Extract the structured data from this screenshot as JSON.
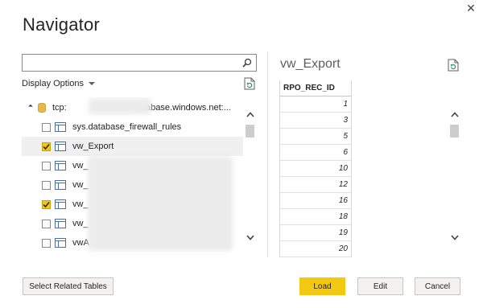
{
  "dialog": {
    "title": "Navigator",
    "close_label": "✕"
  },
  "search": {
    "value": "",
    "placeholder": ""
  },
  "display_options": {
    "label": "Display Options"
  },
  "tree": {
    "root": {
      "label_prefix": "tcp:",
      "label_suffix": ".database.windows.net:..."
    },
    "items": [
      {
        "label": "sys.database_firewall_rules",
        "checked": false
      },
      {
        "label": "vw_Export",
        "checked": true
      },
      {
        "label": "vw_",
        "checked": false
      },
      {
        "label": "vw_",
        "checked": false
      },
      {
        "label": "vw_",
        "checked": true
      },
      {
        "label": "vw_",
        "checked": false
      },
      {
        "label": "vwA",
        "checked": false
      }
    ]
  },
  "preview": {
    "title": "vw_Export",
    "column_header": "RPO_REC_ID",
    "values": [
      "1",
      "3",
      "5",
      "6",
      "10",
      "12",
      "16",
      "18",
      "19",
      "20"
    ]
  },
  "footer": {
    "select_related_label": "Select Related Tables",
    "load_label": "Load",
    "edit_label": "Edit",
    "cancel_label": "Cancel"
  },
  "colors": {
    "accent": "#f2c811",
    "text": "#252423",
    "button_bg": "#f3f2f1"
  },
  "icons": {
    "search": "search-icon",
    "refresh": "refresh-icon",
    "database": "database-icon",
    "table": "table-view-icon",
    "close": "close-icon"
  }
}
